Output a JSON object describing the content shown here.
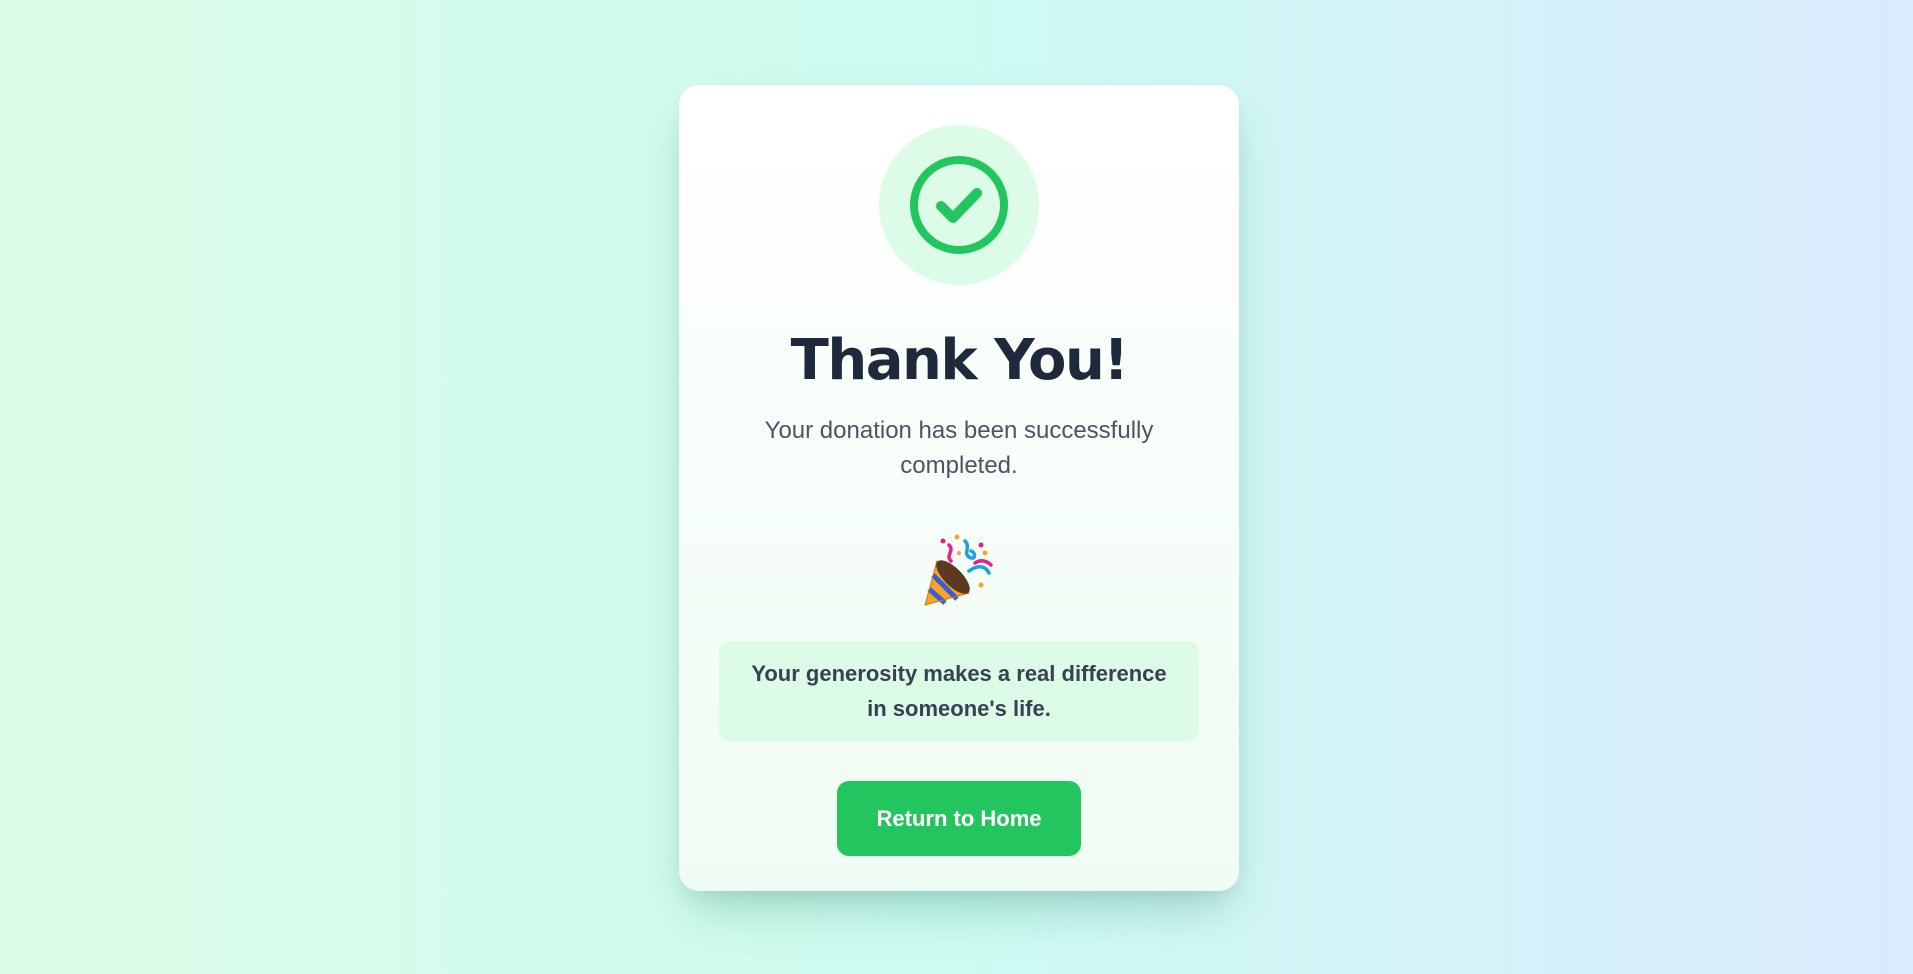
{
  "card": {
    "status_icon": "check-circle-icon",
    "title": "Thank You!",
    "subtitle": "Your donation has been successfully completed.",
    "celebration_icon": "party-popper-icon",
    "message": "Your generosity makes a real difference in someone's life.",
    "button_label": "Return to Home"
  },
  "colors": {
    "accent": "#22c55e",
    "accent_light": "#dcfce7",
    "title": "#1e293b",
    "body_text": "#4b5563"
  }
}
